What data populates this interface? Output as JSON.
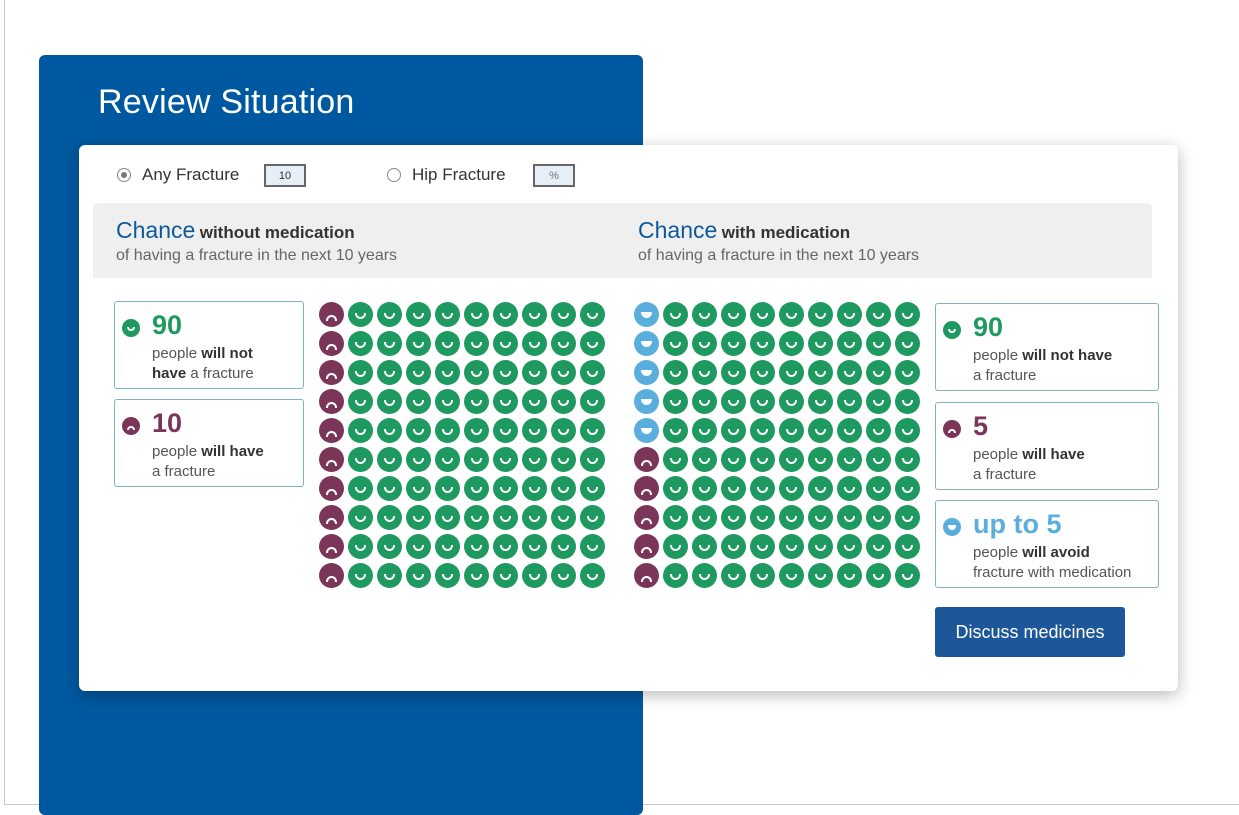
{
  "panel": {
    "title": "Review Situation"
  },
  "options": {
    "any_fracture": {
      "label": "Any Fracture",
      "selected": true,
      "value": "10"
    },
    "hip_fracture": {
      "label": "Hip Fracture",
      "selected": false,
      "placeholder": "%"
    }
  },
  "without": {
    "chance": "Chance",
    "qualifier": "without medication",
    "subtitle": "of having a fracture in the next 10 years",
    "stats": [
      {
        "number": "90",
        "pre": "people ",
        "bold": "will not",
        "mid": " ",
        "bold2": "have",
        "post": " a fracture",
        "kind": "happy"
      },
      {
        "number": "10",
        "pre": "people ",
        "bold": "will have",
        "mid": "",
        "bold2": "",
        "post": "a fracture",
        "kind": "sad"
      }
    ]
  },
  "with": {
    "chance": "Chance",
    "qualifier": "with medication",
    "subtitle": "of having a fracture in the next 10 years",
    "stats": [
      {
        "number": "90",
        "pre": "people ",
        "bold": "will not have",
        "post": "a fracture",
        "kind": "happy"
      },
      {
        "number": "5",
        "pre": "people ",
        "bold": "will have",
        "post": "a fracture",
        "kind": "sad"
      },
      {
        "number": "up to 5",
        "pre": "people ",
        "bold": "will avoid",
        "post": "fracture with medication",
        "kind": "avoid"
      }
    ]
  },
  "chart_data": [
    {
      "type": "icon-array",
      "grid": {
        "rows": 10,
        "cols": 10,
        "fill_order": "column-first"
      },
      "counts": {
        "happy": 90,
        "sad": 10,
        "avoid": 0
      }
    },
    {
      "type": "icon-array",
      "grid": {
        "rows": 10,
        "cols": 10,
        "fill_order": "column-first"
      },
      "counts": {
        "happy": 90,
        "sad": 5,
        "avoid": 5
      }
    }
  ],
  "colors": {
    "happy": "#1e9a60",
    "sad": "#7a3558",
    "avoid": "#5aaedd",
    "panel": "#0059a0",
    "button": "#1d5699"
  },
  "actions": {
    "discuss_label": "Discuss medicines"
  }
}
